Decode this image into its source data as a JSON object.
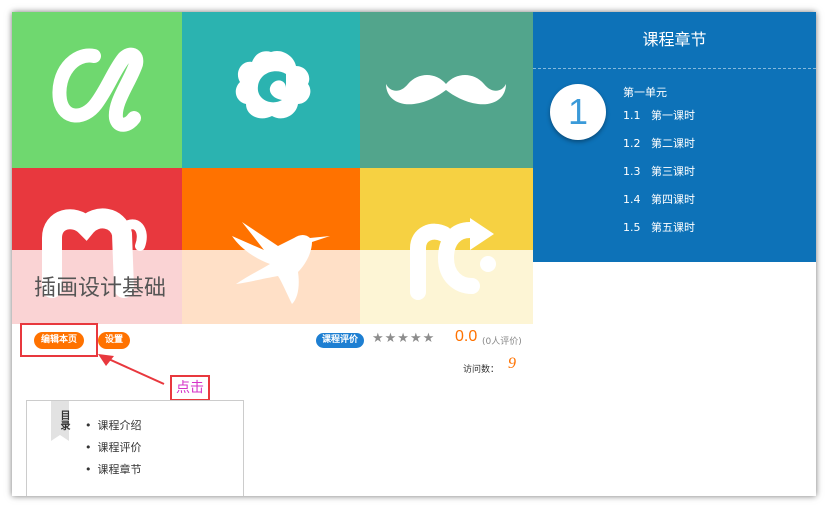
{
  "course": {
    "title": "插画设计基础"
  },
  "chapter_panel": {
    "heading": "课程章节",
    "unit_number": "1",
    "unit_title": "第一单元",
    "lessons": [
      {
        "number": "1.1",
        "title": "第一课时"
      },
      {
        "number": "1.2",
        "title": "第二课时"
      },
      {
        "number": "1.3",
        "title": "第三课时"
      },
      {
        "number": "1.4",
        "title": "第四课时"
      },
      {
        "number": "1.5",
        "title": "第五课时"
      }
    ]
  },
  "toolbar": {
    "edit_label": "编辑本页",
    "settings_label": "设置",
    "click_hint": "点击"
  },
  "rating": {
    "badge": "课程评价",
    "stars": "★★★★★",
    "score": "0.0",
    "count": "(0人评价)",
    "visits_label": "访问数：",
    "visits_value": "9"
  },
  "toc": {
    "tab_label": "目录",
    "items": [
      "课程介绍",
      "课程评价",
      "课程章节"
    ]
  },
  "colors": {
    "tile_green": "#6fd86f",
    "tile_teal": "#2bb3b0",
    "tile_sage": "#52a58c",
    "tile_red": "#e8383e",
    "tile_orange": "#ff7200",
    "tile_yellow": "#f6d142",
    "panel_blue": "#0d72b8",
    "accent_orange": "#ff7200"
  },
  "icons": [
    "alpha-logo-icon",
    "cloud-swirl-logo-icon",
    "mustache-logo-icon",
    "n-logo-icon",
    "hummingbird-logo-icon",
    "rc-arrow-logo-icon",
    "star-icon",
    "arrow-annotation-icon"
  ]
}
